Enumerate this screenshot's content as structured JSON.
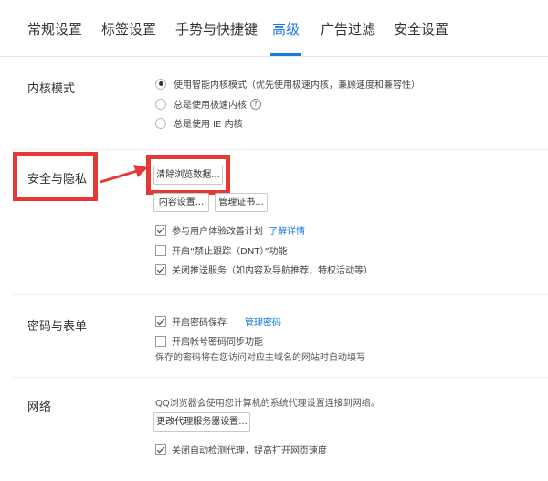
{
  "tabs": [
    {
      "label": "常规设置"
    },
    {
      "label": "标签设置"
    },
    {
      "label": "手势与快捷键"
    },
    {
      "label": "高级"
    },
    {
      "label": "广告过滤"
    },
    {
      "label": "安全设置"
    }
  ],
  "kernel": {
    "title": "内核模式",
    "options": [
      {
        "label": "使用智能内核模式（优先使用极速内核，兼顾速度和兼容性）",
        "selected": true
      },
      {
        "label": "总是使用极速内核",
        "selected": false
      },
      {
        "label": "总是使用 IE 内核",
        "selected": false
      }
    ],
    "help_glyph": "?"
  },
  "security": {
    "title": "安全与隐私",
    "clear_button": "清除浏览数据...",
    "content_button": "内容设置...",
    "cert_button": "管理证书...",
    "checks": [
      {
        "label": "参与用户体验改善计划",
        "checked": true,
        "link": "了解详情"
      },
      {
        "label": "开启“禁止跟踪（DNT）”功能",
        "checked": false
      },
      {
        "label": "关闭推送服务（如内容及导航推荐，特权活动等）",
        "checked": true
      }
    ]
  },
  "password": {
    "title": "密码与表单",
    "checks": [
      {
        "label": "开启密码保存",
        "checked": true,
        "link": "管理密码"
      },
      {
        "label": "开启帐号密码同步功能",
        "checked": false
      }
    ],
    "note": "保存的密码将在您访问对应主域名的网站时自动填写"
  },
  "network": {
    "title": "网络",
    "note": "QQ浏览器会使用您计算机的系统代理设置连接到网络。",
    "proxy_button": "更改代理服务器设置...",
    "checks": [
      {
        "label": "关闭自动检测代理，提高打开网页速度",
        "checked": true
      }
    ]
  },
  "colors": {
    "accent": "#1a7be0",
    "highlight": "#e53935"
  }
}
